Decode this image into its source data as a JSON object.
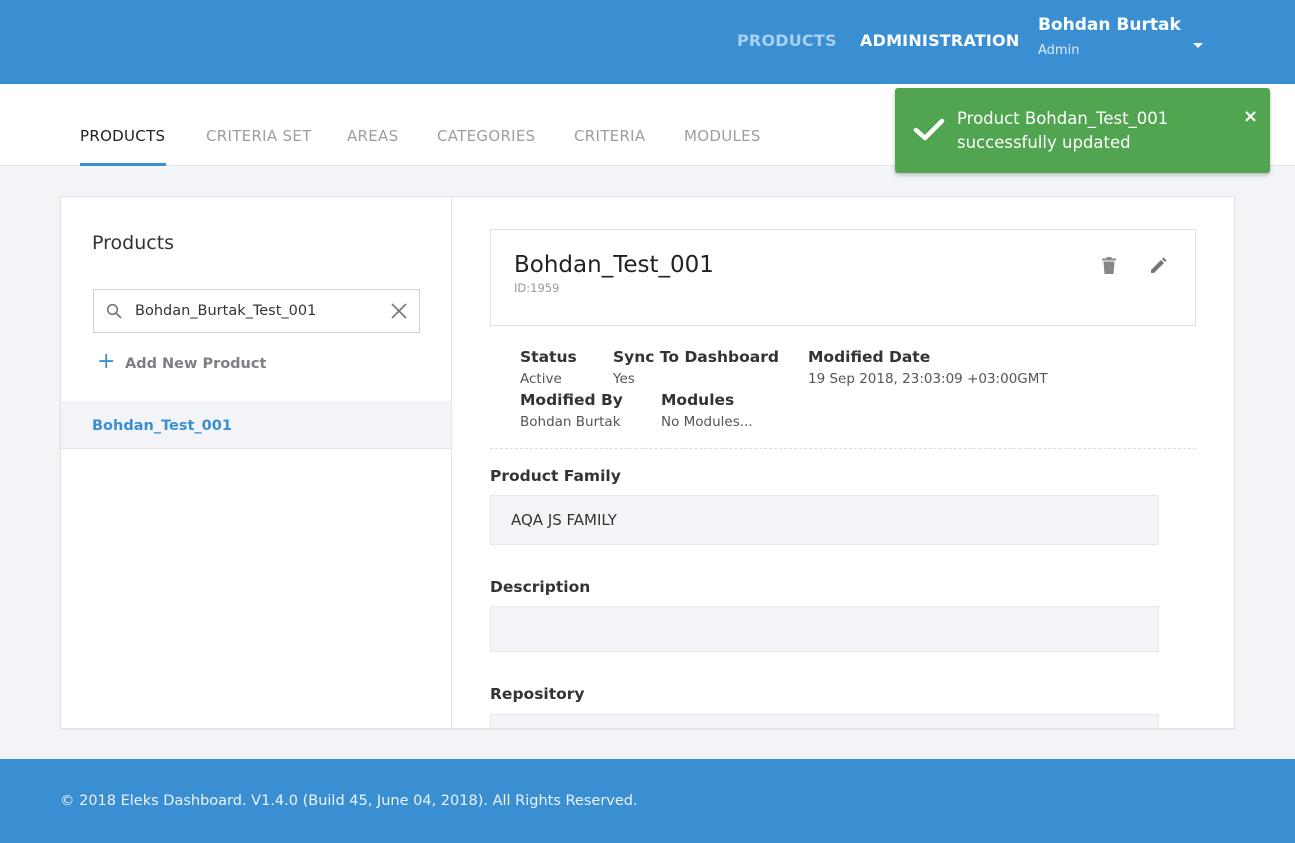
{
  "topnav": {
    "products": "PRODUCTS",
    "administration": "ADMINISTRATION",
    "user_name": "Bohdan Burtak",
    "user_role": "Admin"
  },
  "tabs": [
    {
      "label": "PRODUCTS",
      "active": true
    },
    {
      "label": "CRITERIA SET",
      "active": false
    },
    {
      "label": "AREAS",
      "active": false
    },
    {
      "label": "CATEGORIES",
      "active": false
    },
    {
      "label": "CRITERIA",
      "active": false
    },
    {
      "label": "MODULES",
      "active": false
    }
  ],
  "toast": {
    "message_line1": "Product Bohdan_Test_001",
    "message_line2": "successfully updated",
    "close": "×"
  },
  "sidebar": {
    "title": "Products",
    "search_value": "Bohdan_Burtak_Test_001",
    "add_label": "Add New Product",
    "add_icon": "+",
    "items": [
      {
        "label": "Bohdan_Test_001",
        "selected": true
      }
    ]
  },
  "detail": {
    "title": "Bohdan_Test_001",
    "id": "ID:1959",
    "status_label": "Status",
    "status_value": "Active",
    "sync_label": "Sync To Dashboard",
    "sync_value": "Yes",
    "modified_date_label": "Modified Date",
    "modified_date_value": "19 Sep 2018, 23:03:09 +03:00GMT",
    "modified_by_label": "Modified By",
    "modified_by_value": "Bohdan Burtak",
    "modules_label": "Modules",
    "modules_value": "No Modules...",
    "product_family_label": "Product Family",
    "product_family_value": "AQA JS FAMILY",
    "description_label": "Description",
    "description_value": "",
    "repository_label": "Repository",
    "repository_value": ""
  },
  "footer": {
    "text": "© 2018 Eleks Dashboard. V1.4.0 (Build 45, June 04, 2018). All Rights Reserved."
  },
  "colors": {
    "primary": "#3a8fd3",
    "success": "#51a551",
    "background": "#f3f4f7"
  }
}
